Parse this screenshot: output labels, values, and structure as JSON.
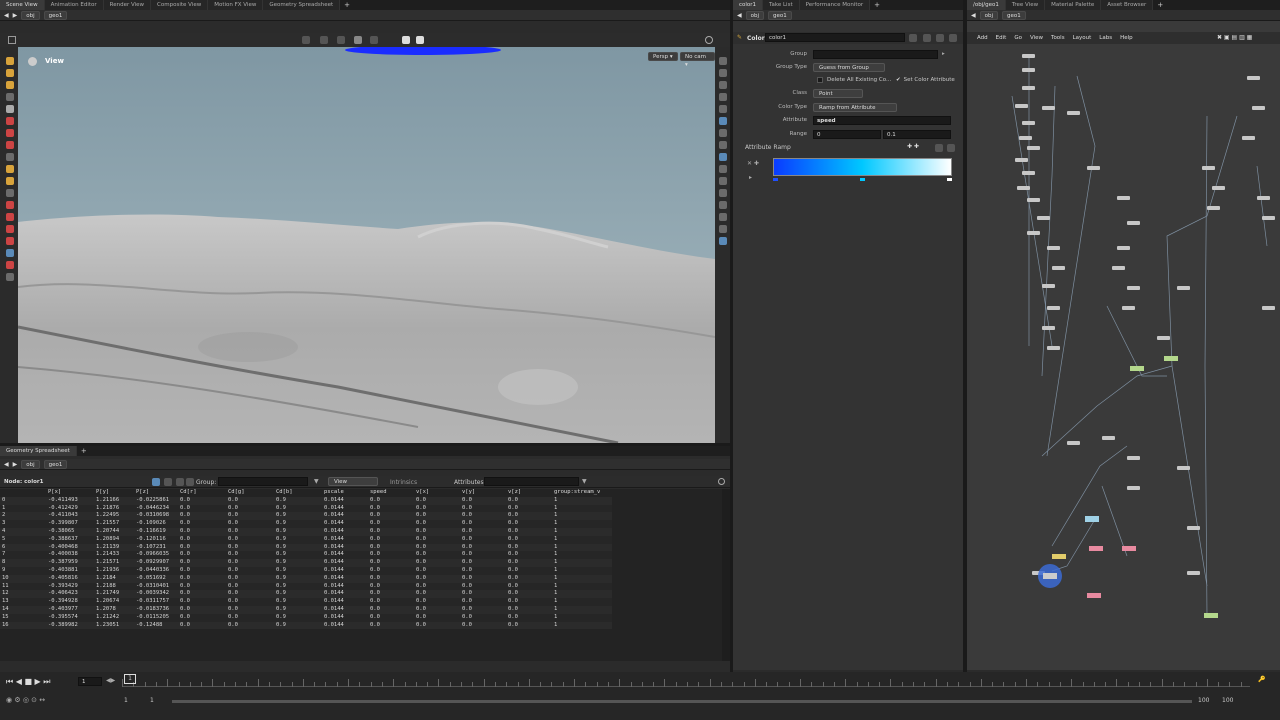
{
  "top_tabs_left": [
    "Scene View",
    "Animation Editor",
    "Render View",
    "Composite View",
    "Motion FX View",
    "Geometry Spreadsheet"
  ],
  "top_tabs_mid": [
    "color1",
    "Take List",
    "Performance Monitor"
  ],
  "top_tabs_right": [
    "/obj/geo1",
    "Tree View",
    "Material Palette",
    "Asset Browser"
  ],
  "path": {
    "obj": "obj",
    "geo": "geo1"
  },
  "viewport": {
    "label": "View",
    "persp": "Persp ▾",
    "cam": "No cam ▾"
  },
  "params": {
    "node_type": "Color",
    "node_name": "color1",
    "group_label": "Group",
    "group_value": "",
    "group_type_label": "Group Type",
    "group_type_value": "Guess from Group",
    "delete_label": "Delete All Existing Co...",
    "set_color_label": "Set Color Attribute",
    "class_label": "Class",
    "class_value": "Point",
    "color_type_label": "Color Type",
    "color_type_value": "Ramp from Attribute",
    "attribute_label": "Attribute",
    "attribute_value": "speed",
    "range_label": "Range",
    "range_min": "0",
    "range_max": "0.1",
    "ramp_label": "Attribute Ramp"
  },
  "network_menu": [
    "Add",
    "Edit",
    "Go",
    "View",
    "Tools",
    "Layout",
    "Labs",
    "Help"
  ],
  "spreadsheet": {
    "tab": "Geometry Spreadsheet",
    "node_label": "Node: color1",
    "group_label": "Group:",
    "view_label": "View",
    "intrinsics_label": "Intrinsics",
    "attributes_label": "Attributes:",
    "columns": [
      "",
      "P[x]",
      "P[y]",
      "P[z]",
      "Cd[r]",
      "Cd[g]",
      "Cd[b]",
      "pscale",
      "speed",
      "v[x]",
      "v[y]",
      "v[z]",
      "group:stream_v"
    ],
    "rows": [
      [
        "0",
        "-0.411493",
        "1.21166",
        "-0.0225861",
        "0.0",
        "0.0",
        "0.9",
        "0.0144",
        "0.0",
        "0.0",
        "0.0",
        "0.0",
        "1"
      ],
      [
        "1",
        "-0.412429",
        "1.21876",
        "-0.0446234",
        "0.0",
        "0.0",
        "0.9",
        "0.0144",
        "0.0",
        "0.0",
        "0.0",
        "0.0",
        "1"
      ],
      [
        "2",
        "-0.411043",
        "1.22495",
        "-0.0310698",
        "0.0",
        "0.0",
        "0.9",
        "0.0144",
        "0.0",
        "0.0",
        "0.0",
        "0.0",
        "1"
      ],
      [
        "3",
        "-0.399807",
        "1.21557",
        "-0.109026",
        "0.0",
        "0.0",
        "0.9",
        "0.0144",
        "0.0",
        "0.0",
        "0.0",
        "0.0",
        "1"
      ],
      [
        "4",
        "-0.38065",
        "1.20744",
        "-0.116619",
        "0.0",
        "0.0",
        "0.9",
        "0.0144",
        "0.0",
        "0.0",
        "0.0",
        "0.0",
        "1"
      ],
      [
        "5",
        "-0.388637",
        "1.20894",
        "-0.120116",
        "0.0",
        "0.0",
        "0.9",
        "0.0144",
        "0.0",
        "0.0",
        "0.0",
        "0.0",
        "1"
      ],
      [
        "6",
        "-0.400468",
        "1.21139",
        "-0.107231",
        "0.0",
        "0.0",
        "0.9",
        "0.0144",
        "0.0",
        "0.0",
        "0.0",
        "0.0",
        "1"
      ],
      [
        "7",
        "-0.400038",
        "1.21433",
        "-0.0966035",
        "0.0",
        "0.0",
        "0.9",
        "0.0144",
        "0.0",
        "0.0",
        "0.0",
        "0.0",
        "1"
      ],
      [
        "8",
        "-0.387959",
        "1.21571",
        "-0.0929907",
        "0.0",
        "0.0",
        "0.9",
        "0.0144",
        "0.0",
        "0.0",
        "0.0",
        "0.0",
        "1"
      ],
      [
        "9",
        "-0.403881",
        "1.21936",
        "-0.0440336",
        "0.0",
        "0.0",
        "0.9",
        "0.0144",
        "0.0",
        "0.0",
        "0.0",
        "0.0",
        "1"
      ],
      [
        "10",
        "-0.405816",
        "1.2184",
        "-0.051692",
        "0.0",
        "0.0",
        "0.9",
        "0.0144",
        "0.0",
        "0.0",
        "0.0",
        "0.0",
        "1"
      ],
      [
        "11",
        "-0.393429",
        "1.2188",
        "-0.0310401",
        "0.0",
        "0.0",
        "0.9",
        "0.0144",
        "0.0",
        "0.0",
        "0.0",
        "0.0",
        "1"
      ],
      [
        "12",
        "-0.406423",
        "1.21749",
        "-0.0039342",
        "0.0",
        "0.0",
        "0.9",
        "0.0144",
        "0.0",
        "0.0",
        "0.0",
        "0.0",
        "1"
      ],
      [
        "13",
        "-0.394928",
        "1.20674",
        "-0.0311757",
        "0.0",
        "0.0",
        "0.9",
        "0.0144",
        "0.0",
        "0.0",
        "0.0",
        "0.0",
        "1"
      ],
      [
        "14",
        "-0.403977",
        "1.2078",
        "-0.0183736",
        "0.0",
        "0.0",
        "0.9",
        "0.0144",
        "0.0",
        "0.0",
        "0.0",
        "0.0",
        "1"
      ],
      [
        "15",
        "-0.395574",
        "1.21242",
        "-0.0115205",
        "0.0",
        "0.0",
        "0.9",
        "0.0144",
        "0.0",
        "0.0",
        "0.0",
        "0.0",
        "1"
      ],
      [
        "16",
        "-0.389982",
        "1.23051",
        "-0.12488",
        "0.0",
        "0.0",
        "0.9",
        "0.0144",
        "0.0",
        "0.0",
        "0.0",
        "0.0",
        "1"
      ]
    ]
  },
  "timeline": {
    "frame": "1",
    "start1": "1",
    "start2": "1",
    "end1": "100",
    "end2": "100"
  },
  "colors": {
    "ramp_start": "#0a3bff",
    "ramp_mid": "#00c8ff",
    "ramp_end": "#ffffff",
    "sky": "#8fa6b0",
    "sand": "#a8a8a8"
  },
  "network_labels": [
    "timeshift",
    "color1",
    "merge1",
    "attribwrangle1",
    "popnet",
    "dopimport1",
    "output0"
  ]
}
